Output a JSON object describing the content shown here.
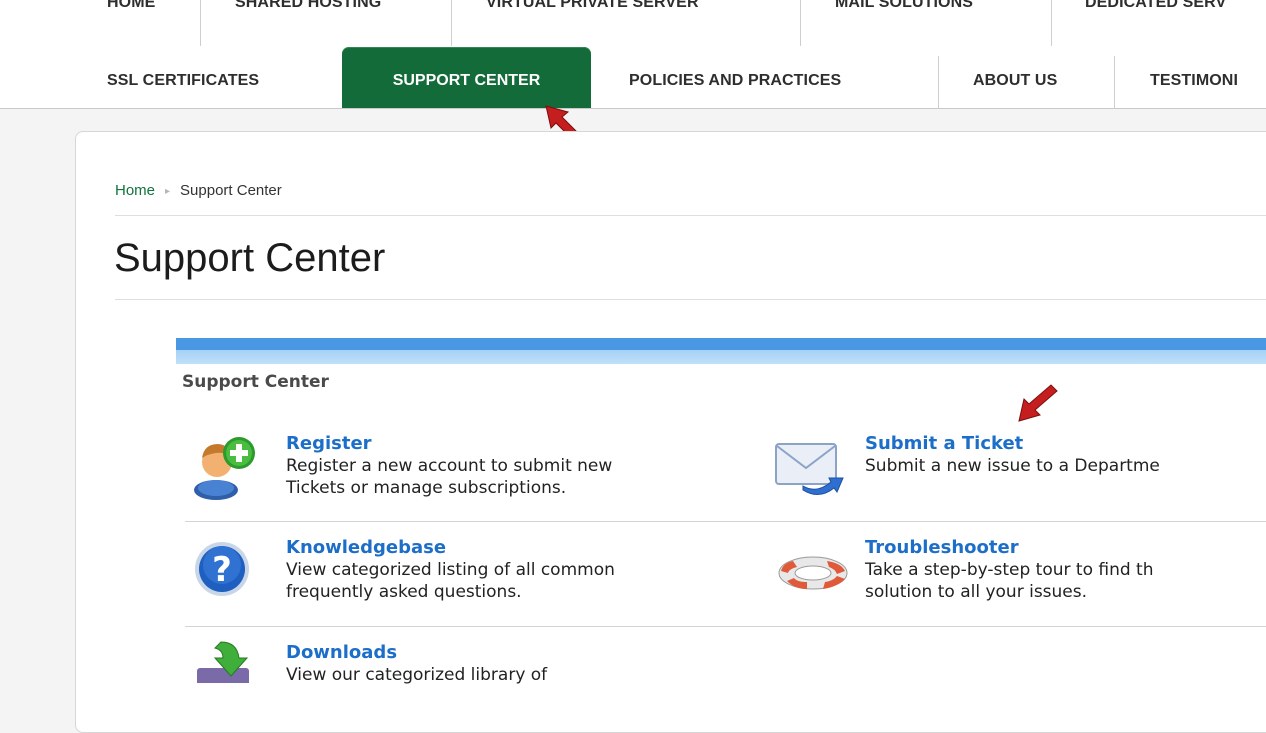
{
  "nav": {
    "row1": [
      "HOME",
      "SHARED HOSTING",
      "VIRTUAL PRIVATE SERVER",
      "MAIL SOLUTIONS",
      "DEDICATED SERV"
    ],
    "row2": [
      "SSL CERTIFICATES",
      "SUPPORT CENTER",
      "POLICIES AND PRACTICES",
      "ABOUT US",
      "TESTIMONI"
    ],
    "active_color": "#146b3a"
  },
  "breadcrumb": {
    "home": "Home",
    "current": "Support Center"
  },
  "page": {
    "title": "Support Center"
  },
  "support": {
    "heading": "Support Center",
    "items": [
      {
        "title": "Register",
        "desc": "Register a new account to submit new\nTickets or manage subscriptions.",
        "icon": "register-user-icon"
      },
      {
        "title": "Submit a Ticket",
        "desc": "Submit a new issue to a Departme",
        "icon": "envelope-icon"
      },
      {
        "title": "Knowledgebase",
        "desc": "View categorized listing of all common\nfrequently asked questions.",
        "icon": "question-mark-icon"
      },
      {
        "title": "Troubleshooter",
        "desc": "Take a step-by-step tour to find th\nsolution to all your issues.",
        "icon": "lifebuoy-icon"
      },
      {
        "title": "Downloads",
        "desc": "View our categorized library of",
        "icon": "download-icon"
      }
    ]
  },
  "colors": {
    "link": "#1c6ec9",
    "breadcrumb_link": "#11733d",
    "annotation_arrow": "#c41e1e",
    "blue_bar": "#4a97e3"
  }
}
